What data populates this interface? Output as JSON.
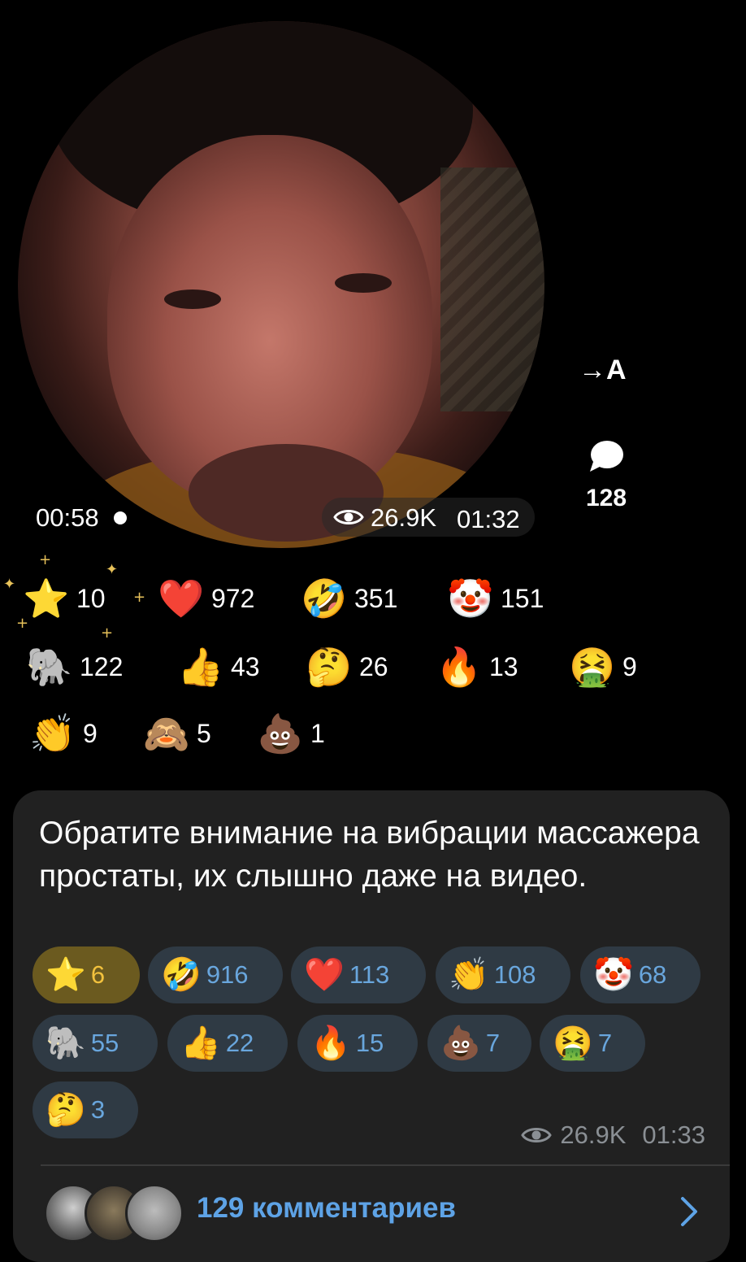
{
  "video": {
    "elapsed": "00:58",
    "views": "26.9K",
    "time": "01:32"
  },
  "side": {
    "translate_label": "→A",
    "comments_count": "128"
  },
  "top_reactions": [
    {
      "emoji": "⭐",
      "count": "10"
    },
    {
      "emoji": "❤️",
      "count": "972"
    },
    {
      "emoji": "🤣",
      "count": "351"
    },
    {
      "emoji": "🤡",
      "count": "151"
    },
    {
      "emoji": "🐘",
      "count": "122"
    },
    {
      "emoji": "👍",
      "count": "43"
    },
    {
      "emoji": "🤔",
      "count": "26"
    },
    {
      "emoji": "🔥",
      "count": "13"
    },
    {
      "emoji": "🤮",
      "count": "9"
    },
    {
      "emoji": "👏",
      "count": "9"
    },
    {
      "emoji": "🙈",
      "count": "5"
    },
    {
      "emoji": "💩",
      "count": "1"
    }
  ],
  "message": {
    "text": "Обратите внимание на вибрации массажера простаты, их слышно даже на видео.",
    "reactions": [
      {
        "emoji": "⭐",
        "count": "6"
      },
      {
        "emoji": "🤣",
        "count": "916"
      },
      {
        "emoji": "❤️",
        "count": "113"
      },
      {
        "emoji": "👏",
        "count": "108"
      },
      {
        "emoji": "🤡",
        "count": "68"
      },
      {
        "emoji": "🐘",
        "count": "55"
      },
      {
        "emoji": "👍",
        "count": "22"
      },
      {
        "emoji": "🔥",
        "count": "15"
      },
      {
        "emoji": "💩",
        "count": "7"
      },
      {
        "emoji": "🤮",
        "count": "7"
      },
      {
        "emoji": "🤔",
        "count": "3"
      }
    ],
    "views": "26.9K",
    "time": "01:33"
  },
  "comments": {
    "label": "129 комментариев"
  },
  "colors": {
    "background": "#000000",
    "bubble": "#212121",
    "pill": "#2f3a44",
    "pill_active": "#6b5a1f",
    "accent_blue": "#5ea3e6",
    "accent_gold": "#f2c13d"
  }
}
